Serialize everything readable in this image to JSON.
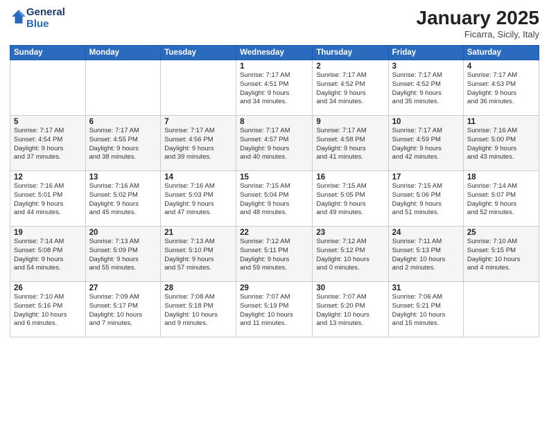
{
  "header": {
    "logo_line1": "General",
    "logo_line2": "Blue",
    "month": "January 2025",
    "location": "Ficarra, Sicily, Italy"
  },
  "weekdays": [
    "Sunday",
    "Monday",
    "Tuesday",
    "Wednesday",
    "Thursday",
    "Friday",
    "Saturday"
  ],
  "weeks": [
    [
      {
        "date": "",
        "info": ""
      },
      {
        "date": "",
        "info": ""
      },
      {
        "date": "",
        "info": ""
      },
      {
        "date": "1",
        "info": "Sunrise: 7:17 AM\nSunset: 4:51 PM\nDaylight: 9 hours\nand 34 minutes."
      },
      {
        "date": "2",
        "info": "Sunrise: 7:17 AM\nSunset: 4:52 PM\nDaylight: 9 hours\nand 34 minutes."
      },
      {
        "date": "3",
        "info": "Sunrise: 7:17 AM\nSunset: 4:52 PM\nDaylight: 9 hours\nand 35 minutes."
      },
      {
        "date": "4",
        "info": "Sunrise: 7:17 AM\nSunset: 4:53 PM\nDaylight: 9 hours\nand 36 minutes."
      }
    ],
    [
      {
        "date": "5",
        "info": "Sunrise: 7:17 AM\nSunset: 4:54 PM\nDaylight: 9 hours\nand 37 minutes."
      },
      {
        "date": "6",
        "info": "Sunrise: 7:17 AM\nSunset: 4:55 PM\nDaylight: 9 hours\nand 38 minutes."
      },
      {
        "date": "7",
        "info": "Sunrise: 7:17 AM\nSunset: 4:56 PM\nDaylight: 9 hours\nand 39 minutes."
      },
      {
        "date": "8",
        "info": "Sunrise: 7:17 AM\nSunset: 4:57 PM\nDaylight: 9 hours\nand 40 minutes."
      },
      {
        "date": "9",
        "info": "Sunrise: 7:17 AM\nSunset: 4:58 PM\nDaylight: 9 hours\nand 41 minutes."
      },
      {
        "date": "10",
        "info": "Sunrise: 7:17 AM\nSunset: 4:59 PM\nDaylight: 9 hours\nand 42 minutes."
      },
      {
        "date": "11",
        "info": "Sunrise: 7:16 AM\nSunset: 5:00 PM\nDaylight: 9 hours\nand 43 minutes."
      }
    ],
    [
      {
        "date": "12",
        "info": "Sunrise: 7:16 AM\nSunset: 5:01 PM\nDaylight: 9 hours\nand 44 minutes."
      },
      {
        "date": "13",
        "info": "Sunrise: 7:16 AM\nSunset: 5:02 PM\nDaylight: 9 hours\nand 45 minutes."
      },
      {
        "date": "14",
        "info": "Sunrise: 7:16 AM\nSunset: 5:03 PM\nDaylight: 9 hours\nand 47 minutes."
      },
      {
        "date": "15",
        "info": "Sunrise: 7:15 AM\nSunset: 5:04 PM\nDaylight: 9 hours\nand 48 minutes."
      },
      {
        "date": "16",
        "info": "Sunrise: 7:15 AM\nSunset: 5:05 PM\nDaylight: 9 hours\nand 49 minutes."
      },
      {
        "date": "17",
        "info": "Sunrise: 7:15 AM\nSunset: 5:06 PM\nDaylight: 9 hours\nand 51 minutes."
      },
      {
        "date": "18",
        "info": "Sunrise: 7:14 AM\nSunset: 5:07 PM\nDaylight: 9 hours\nand 52 minutes."
      }
    ],
    [
      {
        "date": "19",
        "info": "Sunrise: 7:14 AM\nSunset: 5:08 PM\nDaylight: 9 hours\nand 54 minutes."
      },
      {
        "date": "20",
        "info": "Sunrise: 7:13 AM\nSunset: 5:09 PM\nDaylight: 9 hours\nand 55 minutes."
      },
      {
        "date": "21",
        "info": "Sunrise: 7:13 AM\nSunset: 5:10 PM\nDaylight: 9 hours\nand 57 minutes."
      },
      {
        "date": "22",
        "info": "Sunrise: 7:12 AM\nSunset: 5:11 PM\nDaylight: 9 hours\nand 59 minutes."
      },
      {
        "date": "23",
        "info": "Sunrise: 7:12 AM\nSunset: 5:12 PM\nDaylight: 10 hours\nand 0 minutes."
      },
      {
        "date": "24",
        "info": "Sunrise: 7:11 AM\nSunset: 5:13 PM\nDaylight: 10 hours\nand 2 minutes."
      },
      {
        "date": "25",
        "info": "Sunrise: 7:10 AM\nSunset: 5:15 PM\nDaylight: 10 hours\nand 4 minutes."
      }
    ],
    [
      {
        "date": "26",
        "info": "Sunrise: 7:10 AM\nSunset: 5:16 PM\nDaylight: 10 hours\nand 6 minutes."
      },
      {
        "date": "27",
        "info": "Sunrise: 7:09 AM\nSunset: 5:17 PM\nDaylight: 10 hours\nand 7 minutes."
      },
      {
        "date": "28",
        "info": "Sunrise: 7:08 AM\nSunset: 5:18 PM\nDaylight: 10 hours\nand 9 minutes."
      },
      {
        "date": "29",
        "info": "Sunrise: 7:07 AM\nSunset: 5:19 PM\nDaylight: 10 hours\nand 11 minutes."
      },
      {
        "date": "30",
        "info": "Sunrise: 7:07 AM\nSunset: 5:20 PM\nDaylight: 10 hours\nand 13 minutes."
      },
      {
        "date": "31",
        "info": "Sunrise: 7:06 AM\nSunset: 5:21 PM\nDaylight: 10 hours\nand 15 minutes."
      },
      {
        "date": "",
        "info": ""
      }
    ]
  ]
}
